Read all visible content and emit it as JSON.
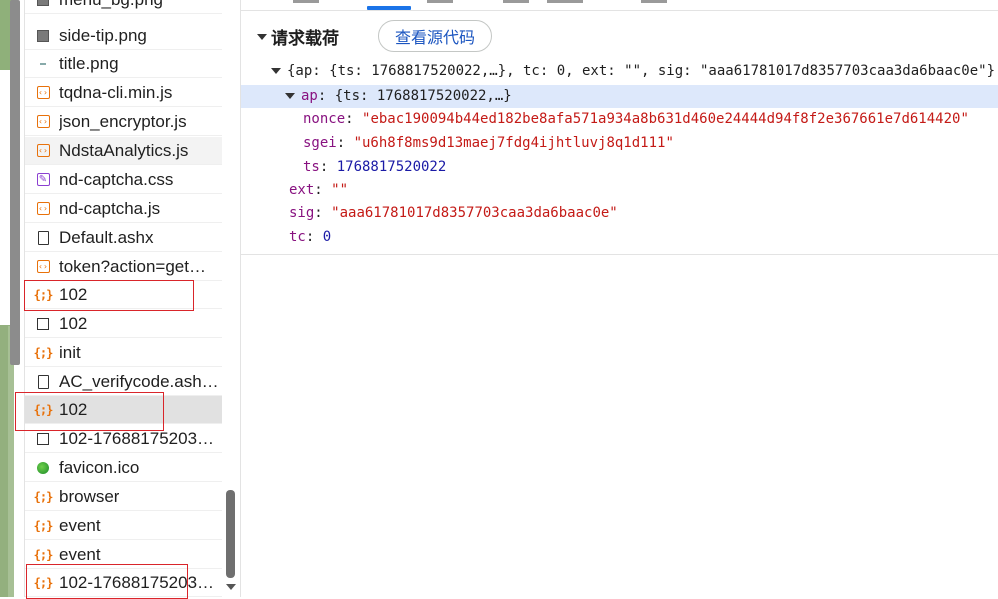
{
  "file_list": {
    "items": [
      {
        "name": "menu_bg.png",
        "icon": "image-icon"
      },
      {
        "name": "side-tip.png",
        "icon": "image-icon"
      },
      {
        "name": "title.png",
        "icon": "dash-icon"
      },
      {
        "name": "tqdna-cli.min.js",
        "icon": "script-icon"
      },
      {
        "name": "json_encryptor.js",
        "icon": "script-icon"
      },
      {
        "name": "NdstaAnalytics.js",
        "icon": "script-icon"
      },
      {
        "name": "nd-captcha.css",
        "icon": "stylesheet-icon"
      },
      {
        "name": "nd-captcha.js",
        "icon": "script-icon"
      },
      {
        "name": "Default.ashx",
        "icon": "document-icon"
      },
      {
        "name": "token?action=get…",
        "icon": "script-icon"
      },
      {
        "name": "102",
        "icon": "fetch-icon"
      },
      {
        "name": "102",
        "icon": "document-box-icon"
      },
      {
        "name": "init",
        "icon": "fetch-icon"
      },
      {
        "name": "AC_verifycode.ash…",
        "icon": "document-icon"
      },
      {
        "name": "102",
        "icon": "fetch-icon"
      },
      {
        "name": "102-17688175203…",
        "icon": "document-box-icon"
      },
      {
        "name": "favicon.ico",
        "icon": "favicon-icon"
      },
      {
        "name": "browser",
        "icon": "fetch-icon"
      },
      {
        "name": "event",
        "icon": "fetch-icon"
      },
      {
        "name": "event",
        "icon": "fetch-icon"
      },
      {
        "name": "102-17688175203…",
        "icon": "fetch-icon"
      }
    ]
  },
  "payload": {
    "section_title": "请求载荷",
    "view_source_label": "查看源代码",
    "root_summary": "{ap: {ts: 1768817520022,…}, tc: 0, ext: \"\", sig: \"aaa61781017d8357703caa3da6baac0e\"}",
    "ap_key": "ap",
    "ap_summary": "{ts: 1768817520022,…}",
    "nonce_key": "nonce",
    "nonce_value": "\"ebac190094b44ed182be8afa571a934a8b631d460e24444d94f8f2e367661e7d614420\"",
    "sgei_key": "sgei",
    "sgei_value": "\"u6h8f8ms9d13maej7fdg4ijhtluvj8q1d111\"",
    "ts_key": "ts",
    "ts_value": "1768817520022",
    "ext_key": "ext",
    "ext_value": "\"\"",
    "sig_key": "sig",
    "sig_value": "\"aaa61781017d8357703caa3da6baac0e\"",
    "tc_key": "tc",
    "tc_value": "0"
  },
  "colors": {
    "key": "#881280",
    "string": "#c41a16",
    "number": "#1a1aa6",
    "highlight_row": "#dde8fb",
    "selected_tab": "#1a73e8",
    "annotation_box": "#d9252a"
  }
}
